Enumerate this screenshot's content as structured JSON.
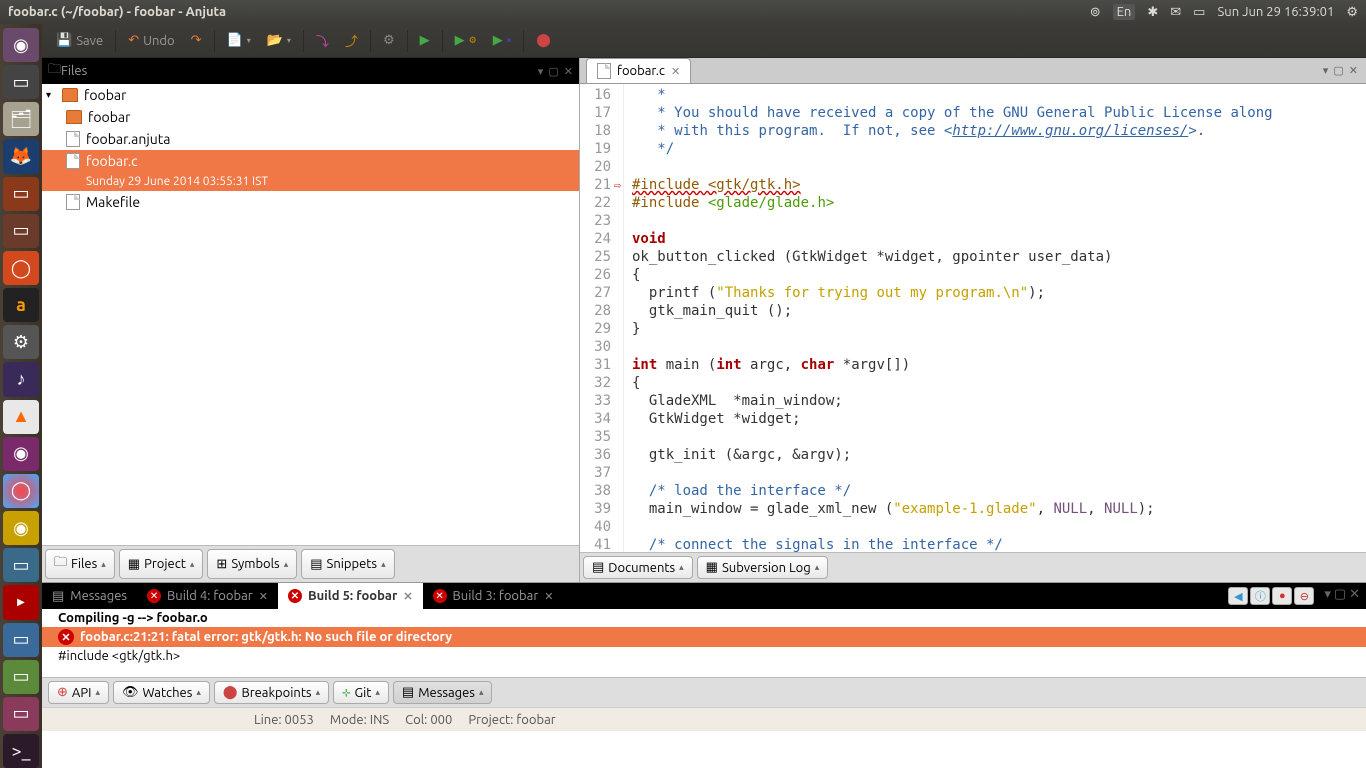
{
  "top_bar": {
    "title": "foobar.c (~/foobar) - foobar - Anjuta",
    "language": "En",
    "datetime": "Sun Jun 29 16:39:01"
  },
  "toolbar": {
    "save": "Save",
    "undo": "Undo"
  },
  "files_panel": {
    "header": "Files",
    "root": "foobar",
    "items": [
      {
        "name": "foobar",
        "type": "folder"
      },
      {
        "name": "foobar.anjuta",
        "type": "file"
      },
      {
        "name": "foobar.c",
        "type": "file",
        "selected": true,
        "subtitle": "Sunday 29 June 2014 03:55:31  IST"
      },
      {
        "name": "Makefile",
        "type": "file"
      }
    ],
    "tabs": [
      "Files",
      "Project",
      "Symbols",
      "Snippets"
    ]
  },
  "editor": {
    "tab_name": "foobar.c",
    "first_line": 16,
    "error_line": 21,
    "lines": [
      {
        "n": 16,
        "html": "   <span class='c-comment'>*</span>"
      },
      {
        "n": 17,
        "html": "   <span class='c-comment'>* You should have received a copy of the GNU General Public License along</span>"
      },
      {
        "n": 18,
        "html": "   <span class='c-comment'>* with this program.  If not, see &lt;<span class='c-link'>http://www.gnu.org/licenses/</span>&gt;.</span>"
      },
      {
        "n": 19,
        "html": "   <span class='c-comment'>*/</span>"
      },
      {
        "n": 20,
        "html": ""
      },
      {
        "n": 21,
        "html": "<span class='c-pre-err'>#include &lt;gtk/gtk.h&gt;</span>"
      },
      {
        "n": 22,
        "html": "<span class='c-pre'>#include</span> <span class='c-inc'>&lt;glade/glade.h&gt;</span>"
      },
      {
        "n": 23,
        "html": ""
      },
      {
        "n": 24,
        "html": "<span class='c-kw'>void</span>"
      },
      {
        "n": 25,
        "html": "ok_button_clicked (GtkWidget *widget, gpointer user_data)"
      },
      {
        "n": 26,
        "html": "{"
      },
      {
        "n": 27,
        "html": "  printf (<span class='c-str'>\"Thanks for trying out my program.\\n\"</span>);"
      },
      {
        "n": 28,
        "html": "  gtk_main_quit ();"
      },
      {
        "n": 29,
        "html": "}"
      },
      {
        "n": 30,
        "html": ""
      },
      {
        "n": 31,
        "html": "<span class='c-kw'>int</span> main (<span class='c-kw'>int</span> argc, <span class='c-kw'>char</span> *argv[])"
      },
      {
        "n": 32,
        "html": "{"
      },
      {
        "n": 33,
        "html": "  GladeXML  *main_window;"
      },
      {
        "n": 34,
        "html": "  GtkWidget *widget;"
      },
      {
        "n": 35,
        "html": ""
      },
      {
        "n": 36,
        "html": "  gtk_init (&amp;argc, &amp;argv);"
      },
      {
        "n": 37,
        "html": ""
      },
      {
        "n": 38,
        "html": "  <span class='c-comment'>/* load the interface */</span>"
      },
      {
        "n": 39,
        "html": "  main_window = glade_xml_new (<span class='c-str'>\"example-1.glade\"</span>, <span class='c-null'>NULL</span>, <span class='c-null'>NULL</span>);"
      },
      {
        "n": 40,
        "html": ""
      },
      {
        "n": 41,
        "html": "  <span class='c-comment'>/* connect the signals in the interface */</span>"
      }
    ],
    "bottom_tabs": [
      "Documents",
      "Subversion Log"
    ]
  },
  "messages": {
    "tabs": [
      {
        "label": "Messages",
        "icon": "msg",
        "active": false
      },
      {
        "label": "Build 4: foobar",
        "icon": "err",
        "active": false
      },
      {
        "label": "Build 5: foobar",
        "icon": "err",
        "active": true
      },
      {
        "label": "Build 3: foobar",
        "icon": "err",
        "active": false
      }
    ],
    "lines": [
      {
        "text": "Compiling -g --> foobar.o",
        "cls": "bold"
      },
      {
        "text": "foobar.c:21:21: fatal error: gtk/gtk.h: No such file or directory",
        "cls": "err"
      },
      {
        "text": "#include <gtk/gtk.h>",
        "cls": ""
      }
    ],
    "bottom_tabs": [
      "API",
      "Watches",
      "Breakpoints",
      "Git",
      "Messages"
    ]
  },
  "statusbar": {
    "line": "Line: 0053",
    "mode": "Mode: INS",
    "col": "Col: 000",
    "project": "Project: foobar"
  }
}
